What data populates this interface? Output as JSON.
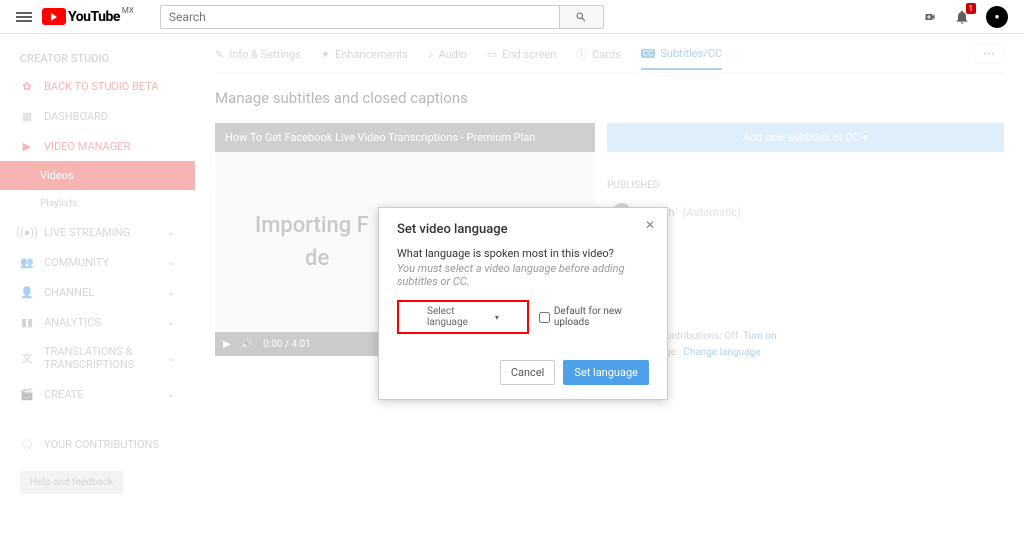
{
  "header": {
    "logo_text": "YouTube",
    "logo_region": "MX",
    "search_placeholder": "Search",
    "notification_count": "1"
  },
  "sidebar": {
    "title": "CREATOR STUDIO",
    "back": "BACK TO STUDIO BETA",
    "items": [
      {
        "label": "DASHBOARD"
      },
      {
        "label": "VIDEO MANAGER"
      },
      {
        "label": "Videos"
      },
      {
        "label": "Playlists"
      },
      {
        "label": "LIVE STREAMING"
      },
      {
        "label": "COMMUNITY"
      },
      {
        "label": "CHANNEL"
      },
      {
        "label": "ANALYTICS"
      },
      {
        "label": "TRANSLATIONS & TRANSCRIPTIONS"
      },
      {
        "label": "CREATE"
      },
      {
        "label": "YOUR CONTRIBUTIONS"
      }
    ],
    "help": "Help and feedback"
  },
  "tabs": {
    "info": "Info & Settings",
    "enh": "Enhancements",
    "audio": "Audio",
    "end": "End screen",
    "cards": "Cards",
    "cc": "Subtitles/CC"
  },
  "page": {
    "title": "Manage subtitles and closed captions",
    "video_title": "How To Get Facebook Live Video Transcriptions - Premium Plan",
    "preview_line1": "Importing F",
    "preview_line2": "de",
    "time": "0:00 / 4:01",
    "add_button": "Add new subtitles or CC ▾",
    "published": "PUBLISHED",
    "lang": "English",
    "lang_type": "(Automatic)",
    "contrib_label": "Community contributions:",
    "contrib_value": "Off",
    "contrib_link": "Turn on",
    "vlang_label": "Video language:",
    "vlang_link": "Change language"
  },
  "modal": {
    "title": "Set video language",
    "question": "What language is spoken most in this video?",
    "hint": "You must select a video language before adding subtitles or CC.",
    "select": "Select language",
    "default": "Default for new uploads",
    "cancel": "Cancel",
    "set": "Set language"
  }
}
